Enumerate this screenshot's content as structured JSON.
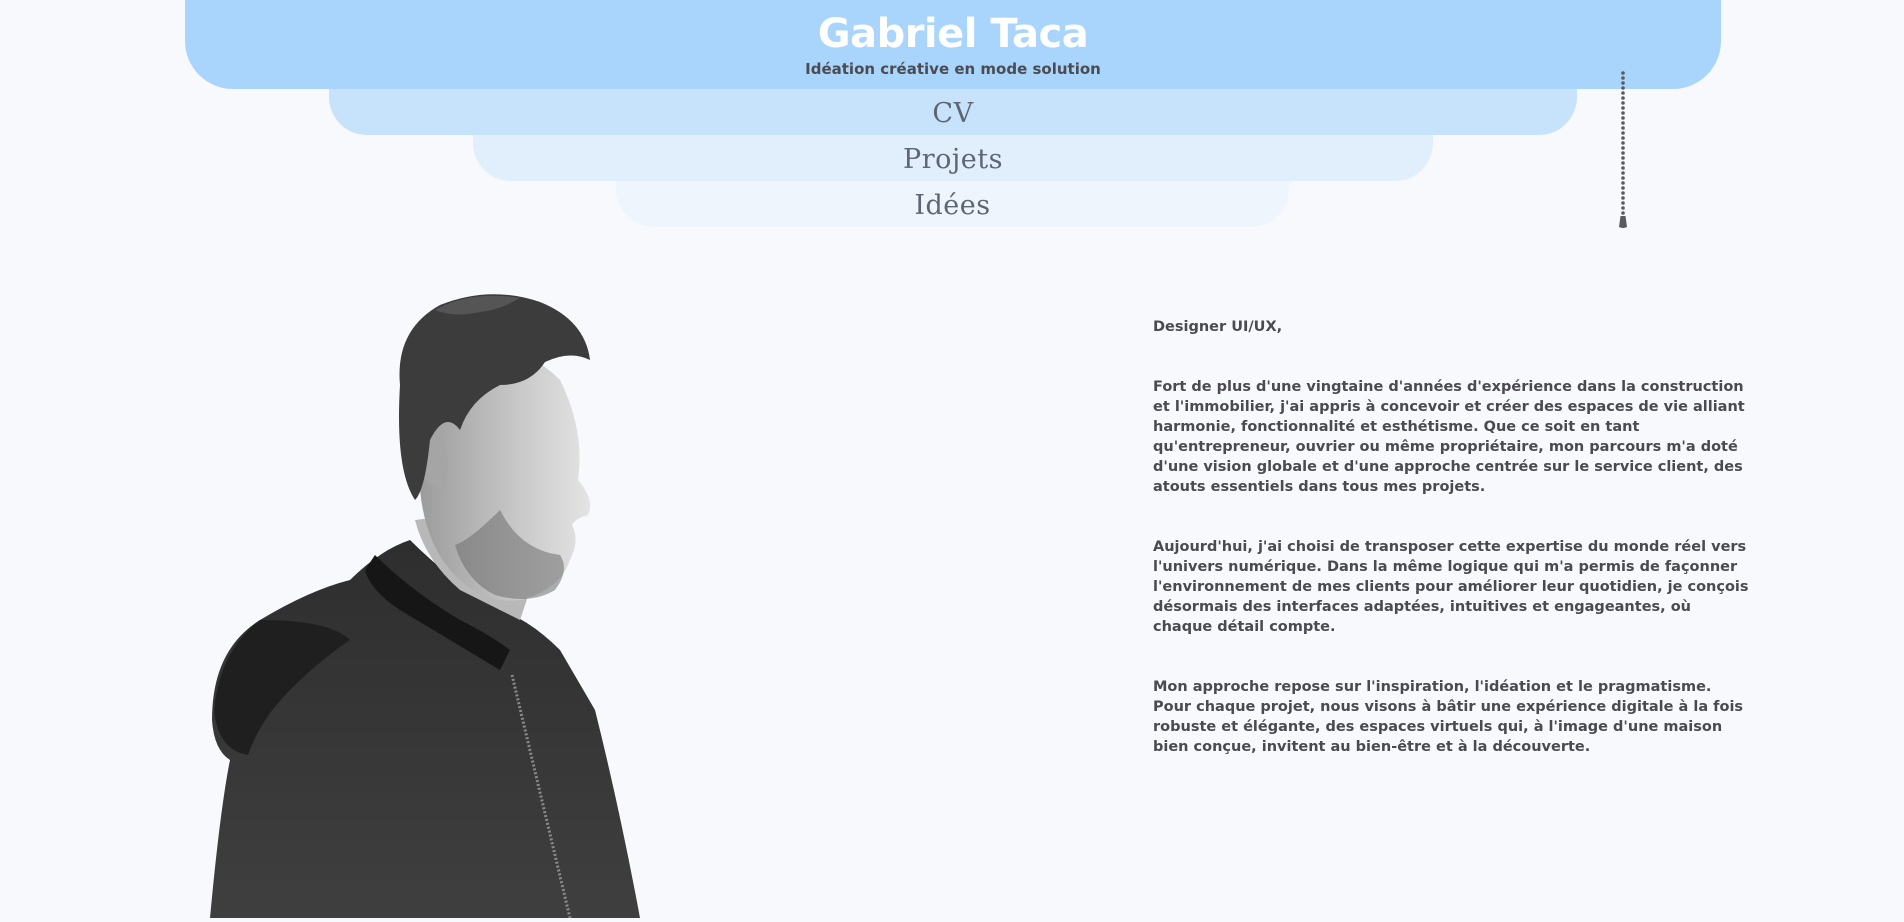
{
  "header": {
    "title": "Gabriel Taca",
    "tagline": "Idéation créative en mode solution"
  },
  "nav": {
    "items": [
      {
        "label": "CV"
      },
      {
        "label": "Projets"
      },
      {
        "label": "Idées"
      }
    ]
  },
  "bio": {
    "role": "Designer UI/UX,",
    "paragraphs": [
      "Fort de plus d'une vingtaine d'années d'expérience dans la construction et l'immobilier, j'ai appris à concevoir et créer des espaces de vie alliant harmonie, fonctionnalité et esthétisme. Que ce soit en tant qu'entrepreneur, ouvrier ou même propriétaire, mon parcours m'a doté d'une vision globale et d'une approche centrée sur le service client, des atouts essentiels dans tous mes projets.",
      "Aujourd'hui, j'ai choisi de transposer cette expertise du monde réel vers l'univers numérique. Dans la même logique qui m'a permis de façonner l'environnement de mes clients pour améliorer leur quotidien, je conçois désormais des interfaces adaptées, intuitives et engageantes, où chaque détail compte.",
      "Mon approche repose sur l'inspiration, l'idéation et le pragmatisme. Pour chaque projet, nous visons à bâtir une expérience digitale à la fois robuste et élégante, des espaces virtuels qui, à l'image d'une maison bien conçue, invitent au bien-être et à la découverte."
    ]
  },
  "colors": {
    "background": "#f7f9fc",
    "header_main": "#a9d5fc",
    "nav_cv": "#c7e2fb",
    "nav_projets": "#e1eefc",
    "nav_idees": "#eef5fd",
    "text": "#4a4a50",
    "title_text": "#ffffff"
  },
  "icons": {
    "pull_chain": "pull-chain-icon",
    "portrait": "portrait-photo"
  }
}
